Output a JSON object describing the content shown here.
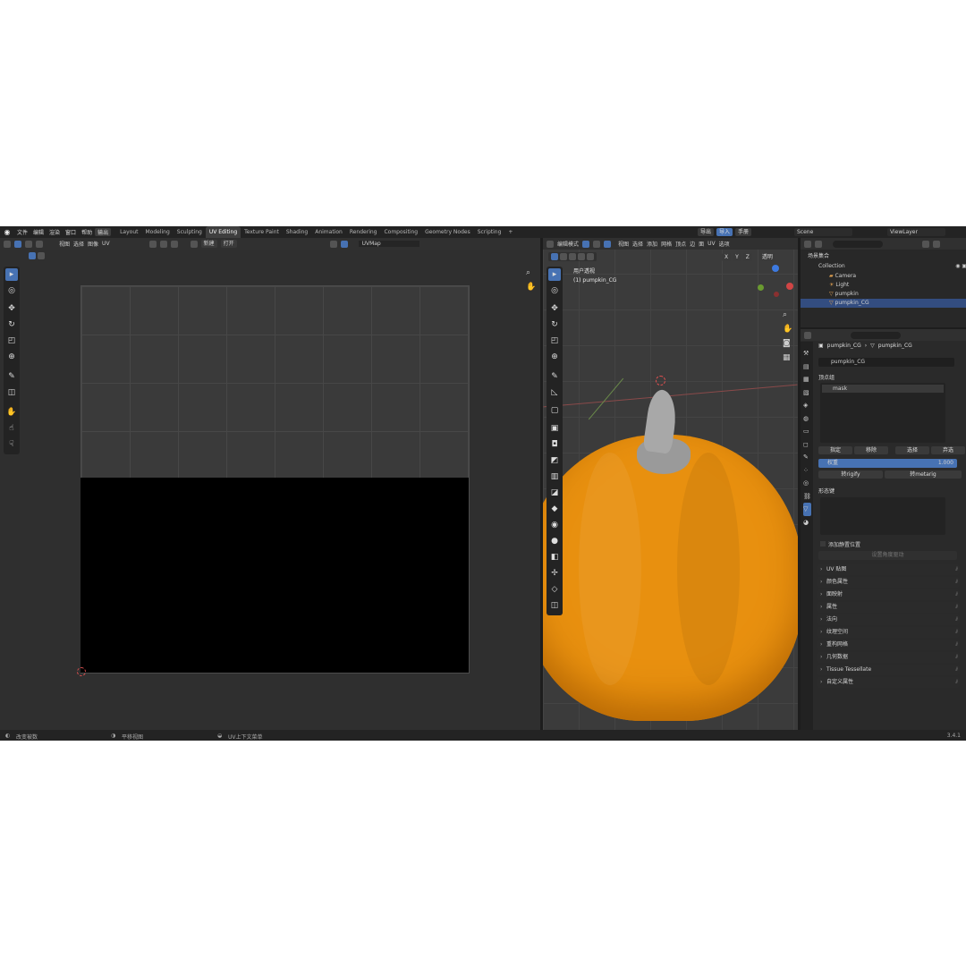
{
  "menu": [
    "文件",
    "编辑",
    "渲染",
    "窗口",
    "帮助",
    "输出"
  ],
  "workspaces": [
    "Layout",
    "Modeling",
    "Sculpting",
    "UV Editing",
    "Texture Paint",
    "Shading",
    "Animation",
    "Rendering",
    "Compositing",
    "Geometry Nodes",
    "Scripting"
  ],
  "workspace_add": "+",
  "top_right": {
    "export": "导出",
    "import": "导入",
    "manual": "手册",
    "scene": "Scene",
    "view_layer": "ViewLayer"
  },
  "uv_header": {
    "view": "视图",
    "select": "选择",
    "image": "图像",
    "uv": "UV",
    "new": "新建",
    "open": "打开",
    "uvmap": "UVMap"
  },
  "viewport_header": {
    "mode": "编辑模式",
    "view": "视图",
    "select": "选择",
    "add": "添加",
    "mesh": "网格",
    "vertex": "顶点",
    "edge": "边",
    "face": "面",
    "uv": "UV",
    "overlay": "选项"
  },
  "viewport_axes": [
    "X",
    "Y",
    "Z"
  ],
  "viewport_overlay_btn": "透明",
  "viewport_info": {
    "title": "用户透视",
    "object": "(1) pumpkin_CG"
  },
  "outliner": {
    "root": "场景集合",
    "collection": "Collection",
    "items": [
      {
        "name": "Camera",
        "icon": "camera-icon"
      },
      {
        "name": "Light",
        "icon": "light-icon"
      },
      {
        "name": "pumpkin",
        "icon": "mesh-icon"
      },
      {
        "name": "pumpkin_CG",
        "icon": "mesh-icon"
      }
    ]
  },
  "properties": {
    "object": "pumpkin_CG",
    "data": "pumpkin_CG",
    "mesh_name": "pumpkin_CG",
    "vertex_groups": {
      "title": "顶点组",
      "item": "mask",
      "assign": "指定",
      "remove": "移除",
      "select": "选择",
      "deselect": "弃选",
      "weight_label": "权重",
      "weight_value": "1.000",
      "to_rigify": "转rigify",
      "to_metarig": "转metarig"
    },
    "shape_keys": {
      "title": "形态键",
      "add_rest": "添加静置位置",
      "setup": "设置角度驱动"
    },
    "panels": [
      "UV 贴图",
      "颜色属性",
      "面映射",
      "属性",
      "法向",
      "纹理空间",
      "重构网格",
      "几何数据",
      "Tissue Tessellate",
      "自定义属性"
    ]
  },
  "status": {
    "left": "改变被数",
    "middle": "平移视图",
    "right": "UV上下文菜单",
    "version": "3.4.1"
  },
  "colors": {
    "accent": "#4772b3",
    "pumpkin": "#e8900f",
    "background": "#1d1d1d",
    "selected_row": "#334d80"
  }
}
